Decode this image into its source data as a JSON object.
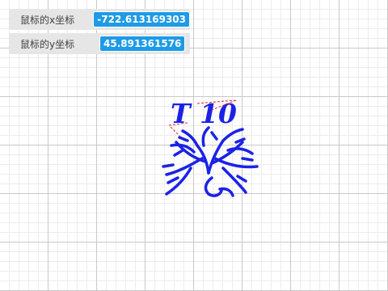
{
  "readouts": {
    "x": {
      "label": "鼠标的x坐标",
      "value": "-722.613169303"
    },
    "y": {
      "label": "鼠标的y坐标",
      "value": "45.891361576"
    }
  },
  "stage": {
    "sprite_text": "T 10",
    "sprite_color": "#1b22e6",
    "guide_color": "#e02020"
  }
}
